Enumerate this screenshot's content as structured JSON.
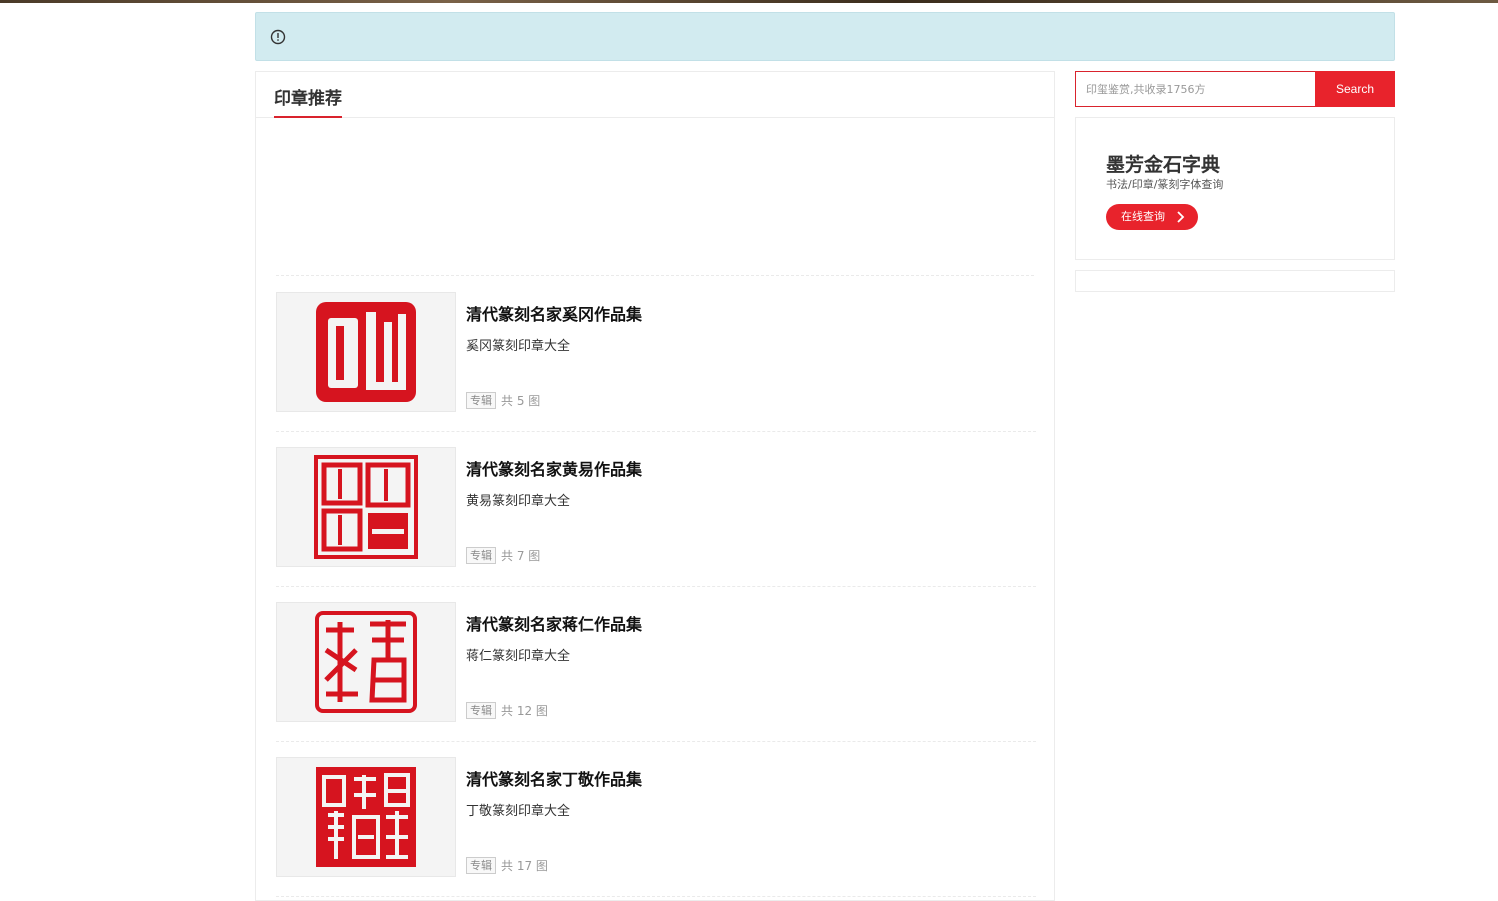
{
  "notice": {
    "icon": "info-circle-icon"
  },
  "main": {
    "title": "印章推荐",
    "items": [
      {
        "title": "清代篆刻名家奚冈作品集",
        "subtitle": "奚冈篆刻印章大全",
        "tag": "专辑",
        "count": "共 5 图"
      },
      {
        "title": "清代篆刻名家黄易作品集",
        "subtitle": "黄易篆刻印章大全",
        "tag": "专辑",
        "count": "共 7 图"
      },
      {
        "title": "清代篆刻名家蒋仁作品集",
        "subtitle": "蒋仁篆刻印章大全",
        "tag": "专辑",
        "count": "共 12 图"
      },
      {
        "title": "清代篆刻名家丁敬作品集",
        "subtitle": "丁敬篆刻印章大全",
        "tag": "专辑",
        "count": "共 17 图"
      }
    ]
  },
  "search": {
    "placeholder": "印玺鉴赏,共收录1756方",
    "button": "Search"
  },
  "promo": {
    "title": "墨芳金石字典",
    "subtitle": "书法/印章/篆刻字体查询",
    "button": "在线查询"
  },
  "colors": {
    "accent": "#e8232c",
    "notice_bg": "#d2ebf0",
    "seal_red": "#d6141f"
  }
}
